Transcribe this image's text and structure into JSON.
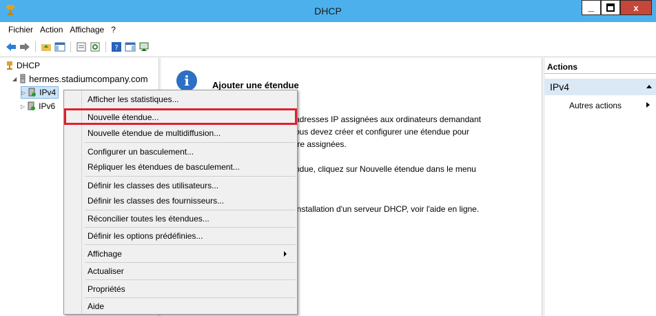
{
  "window": {
    "title": "DHCP"
  },
  "controls": {
    "minimize": "_",
    "close": "x"
  },
  "menubar": {
    "items": [
      "Fichier",
      "Action",
      "Affichage",
      "?"
    ]
  },
  "tree": {
    "root": "DHCP",
    "server": "hermes.stadiumcompany.com",
    "ipv4": "IPv4",
    "ipv6": "IPv6"
  },
  "content": {
    "heading": "Ajouter une étendue",
    "lines": [
      "adresses IP assignées aux ordinateurs demandant",
      "ous devez créer et configurer une étendue pour",
      "tre assignées.",
      "ndue, cliquez sur Nouvelle étendue dans le menu",
      "installation d'un serveur DHCP, voir l'aide en ligne."
    ]
  },
  "actions": {
    "header": "Actions",
    "selected": "IPv4",
    "more": "Autres actions"
  },
  "context_menu": {
    "items": [
      "Afficher les statistiques...",
      "Nouvelle étendue...",
      "Nouvelle étendue de multidiffusion...",
      "Configurer un basculement...",
      "Répliquer les étendues de basculement...",
      "Définir les classes des utilisateurs...",
      "Définir les classes des fournisseurs...",
      "Réconcilier toutes les étendues...",
      "Définir les options prédéfinies...",
      "Affichage",
      "Actualiser",
      "Propriétés",
      "Aide"
    ],
    "highlight_color": "#e0202e"
  }
}
